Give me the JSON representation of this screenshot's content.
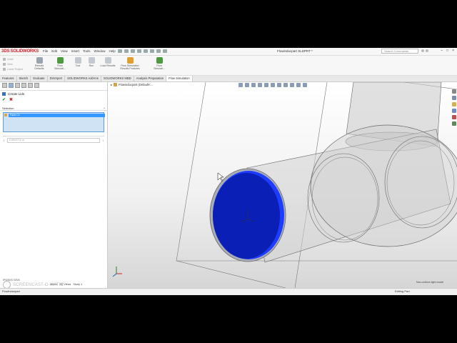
{
  "app": {
    "brand_prefix": "3DS",
    "brand": "SOLIDWORKS",
    "document_title": "Flowinducpart SLDPRT *",
    "search_placeholder": "Search Commands",
    "window_buttons": [
      "–",
      "□",
      "×"
    ]
  },
  "menu": [
    "File",
    "Edit",
    "View",
    "Insert",
    "Tools",
    "Window",
    "Help"
  ],
  "commandmanager": {
    "small_commands": [
      "Undo",
      "View",
      "Lower Project"
    ],
    "groups": [
      {
        "label": "Rebuild Defaults",
        "color": "#9aa4ae"
      },
      {
        "label": "Flow Simulati...",
        "color": "#4c9a3e"
      },
      {
        "label": "Tool",
        "color": "#c3c9cf"
      },
      {
        "label": "Run",
        "color": "#c3c9cf"
      },
      {
        "label": "Load Results",
        "color": "#c3c9cf"
      },
      {
        "label": "Flow Simulation Results Features",
        "color": "#e0a030"
      },
      {
        "label": "Flow Simulati...",
        "color": "#4c9a3e"
      }
    ]
  },
  "tabs": [
    "Features",
    "Sketch",
    "Evaluate",
    "DimXpert",
    "SOLIDWORKS Add-Ins",
    "SOLIDWORKS MBD",
    "Analysis Preparation",
    "Flow Simulation"
  ],
  "active_tab": "Flow Simulation",
  "property_manager": {
    "title": "Create Lids",
    "section": "Selection",
    "selected_item": "Face<1>",
    "option_value": "0.0012712 m",
    "status_units": "IPS/SI/SI  5/5/5",
    "bottom_tabs": [
      "Model",
      "3D Views",
      "Study 1"
    ]
  },
  "viewport": {
    "tree_label": "Flowinducpart (Default<...",
    "note": "Non-uniform light model",
    "accent_face_color": "#0a1fb5",
    "accent_edge_color": "#1d3cff"
  },
  "statusbar": {
    "left": "Flowinducpart",
    "right": "Editing Part"
  },
  "overlay": {
    "watermark": "SCREENCAST-O-MATIC"
  }
}
